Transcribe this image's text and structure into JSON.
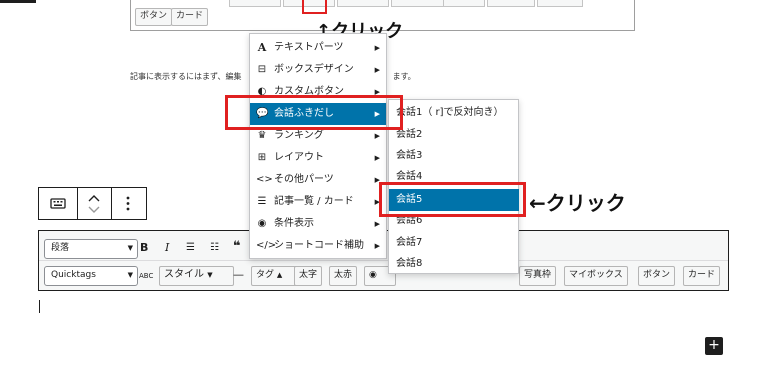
{
  "top_toolbar": {
    "buttons": [
      "ボタン",
      "カード"
    ]
  },
  "annotations": {
    "click_top": "↑クリック",
    "click_right": "←クリック"
  },
  "paragraph": {
    "text_left": "記事に表示するにはまず、編集",
    "text_right": "ます。"
  },
  "editor": {
    "paragraph_select": "段落",
    "quicktags_select": "Quicktags",
    "style_button": "スタイル",
    "tag_button": "タグ",
    "buttons": [
      "太字",
      "太赤",
      "写真枠",
      "マイボックス",
      "ボタン",
      "カード"
    ]
  },
  "menu": {
    "items": [
      {
        "label": "テキストパーツ",
        "icon": "letter-a-icon"
      },
      {
        "label": "ボックスデザイン",
        "icon": "box-icon"
      },
      {
        "label": "カスタムボタン",
        "icon": "toggle-icon"
      },
      {
        "label": "会話ふきだし",
        "icon": "speech-bubbles-icon"
      },
      {
        "label": "ランキング",
        "icon": "crown-icon"
      },
      {
        "label": "レイアウト",
        "icon": "grid-icon"
      },
      {
        "label": "その他パーツ",
        "icon": "code-icon"
      },
      {
        "label": "記事一覧 / カード",
        "icon": "list-icon"
      },
      {
        "label": "条件表示",
        "icon": "eye-icon"
      },
      {
        "label": "ショートコード補助",
        "icon": "code-icon"
      }
    ],
    "active_index": 3
  },
  "submenu": {
    "items": [
      "会話1（ r]で反対向き）",
      "会話2",
      "会話3",
      "会話4",
      "会話5",
      "会話6",
      "会話7",
      "会話8"
    ],
    "active_index": 4
  },
  "colors": {
    "accent": "#0073aa",
    "highlight_border": "#e02020"
  }
}
